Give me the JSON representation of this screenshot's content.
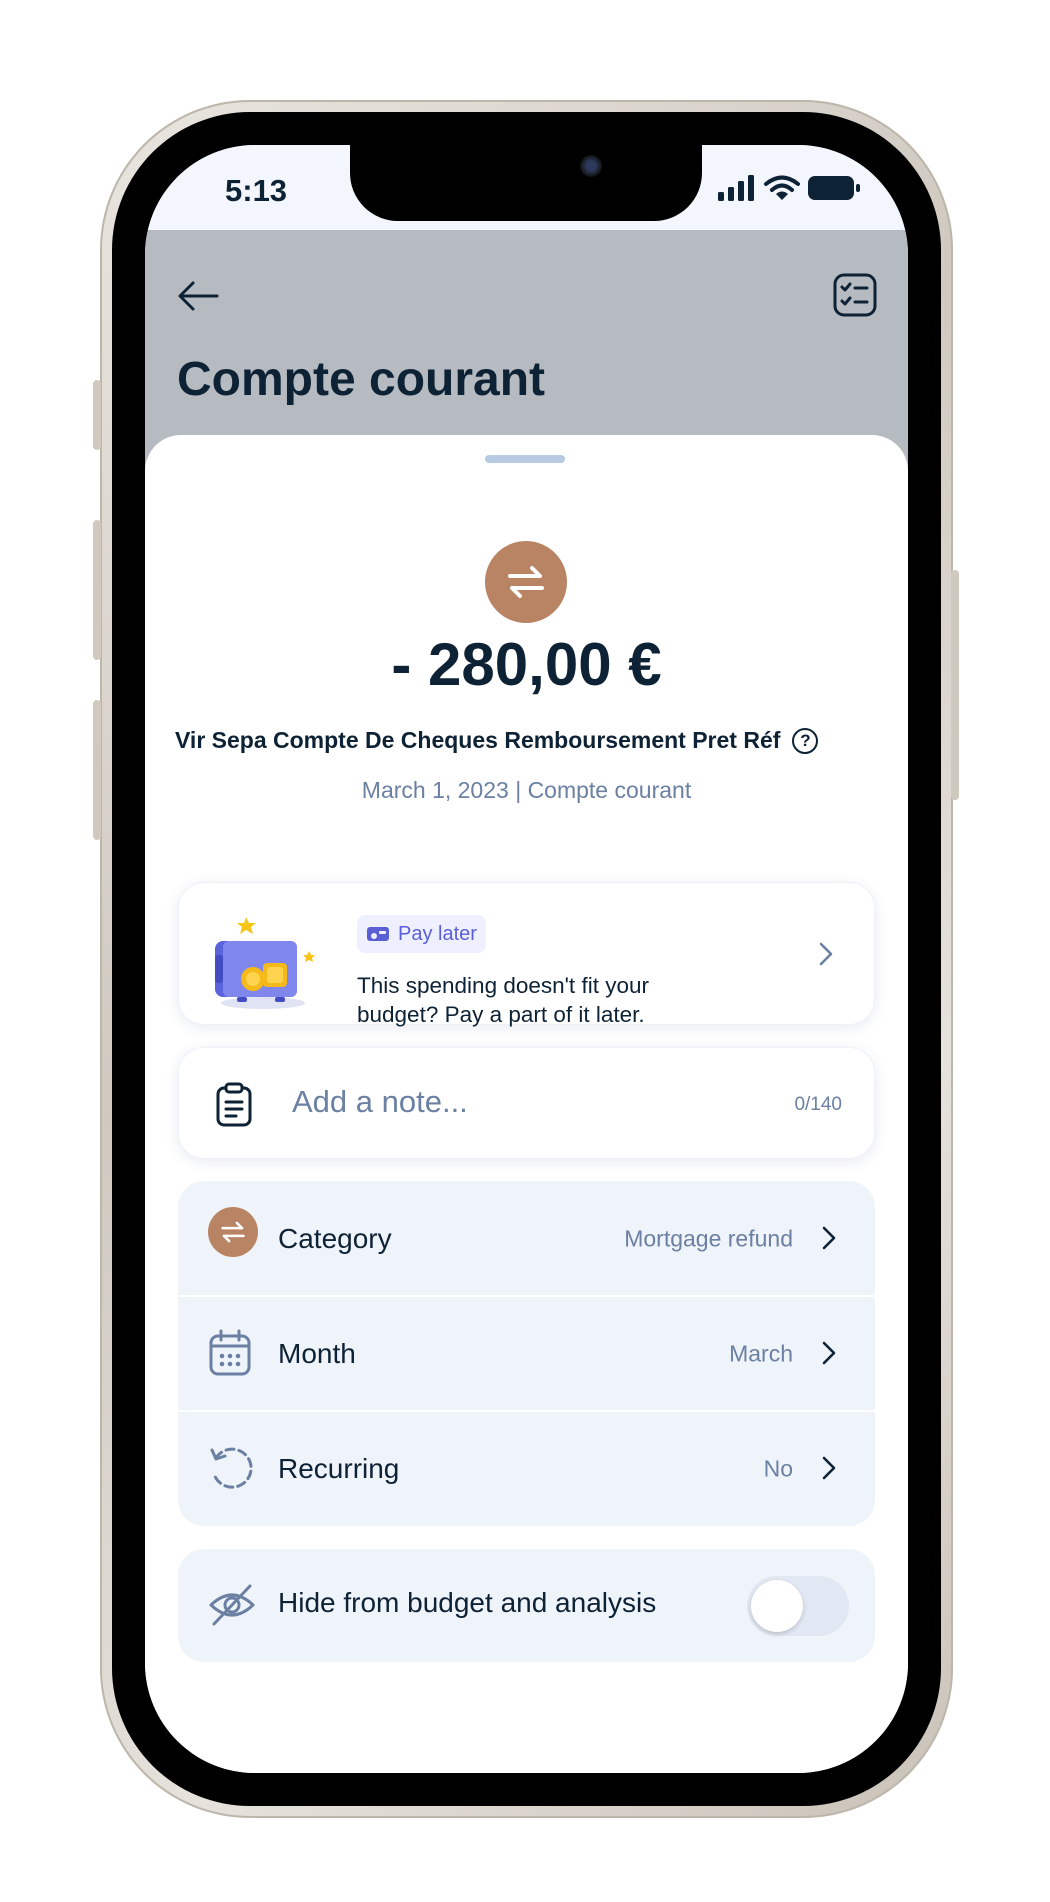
{
  "status_bar": {
    "time": "5:13"
  },
  "header": {
    "title": "Compte courant"
  },
  "transaction": {
    "amount": "- 280,00 €",
    "description": "Vir Sepa Compte De Cheques Remboursement Pret Réf",
    "meta": "March 1, 2023 | Compte courant"
  },
  "pay_later": {
    "badge": "Pay later",
    "text": "This spending doesn't fit your budget? Pay a part of it later."
  },
  "note": {
    "placeholder": "Add a note...",
    "counter": "0/140"
  },
  "details": [
    {
      "label": "Category",
      "value": "Mortgage refund"
    },
    {
      "label": "Month",
      "value": "March"
    },
    {
      "label": "Recurring",
      "value": "No"
    }
  ],
  "hide_option": {
    "label": "Hide from budget and analysis",
    "enabled": false
  },
  "colors": {
    "category": "#b98463",
    "text_primary": "#0e2236",
    "text_secondary": "#6b80a2",
    "badge": "#5b5fd6"
  }
}
